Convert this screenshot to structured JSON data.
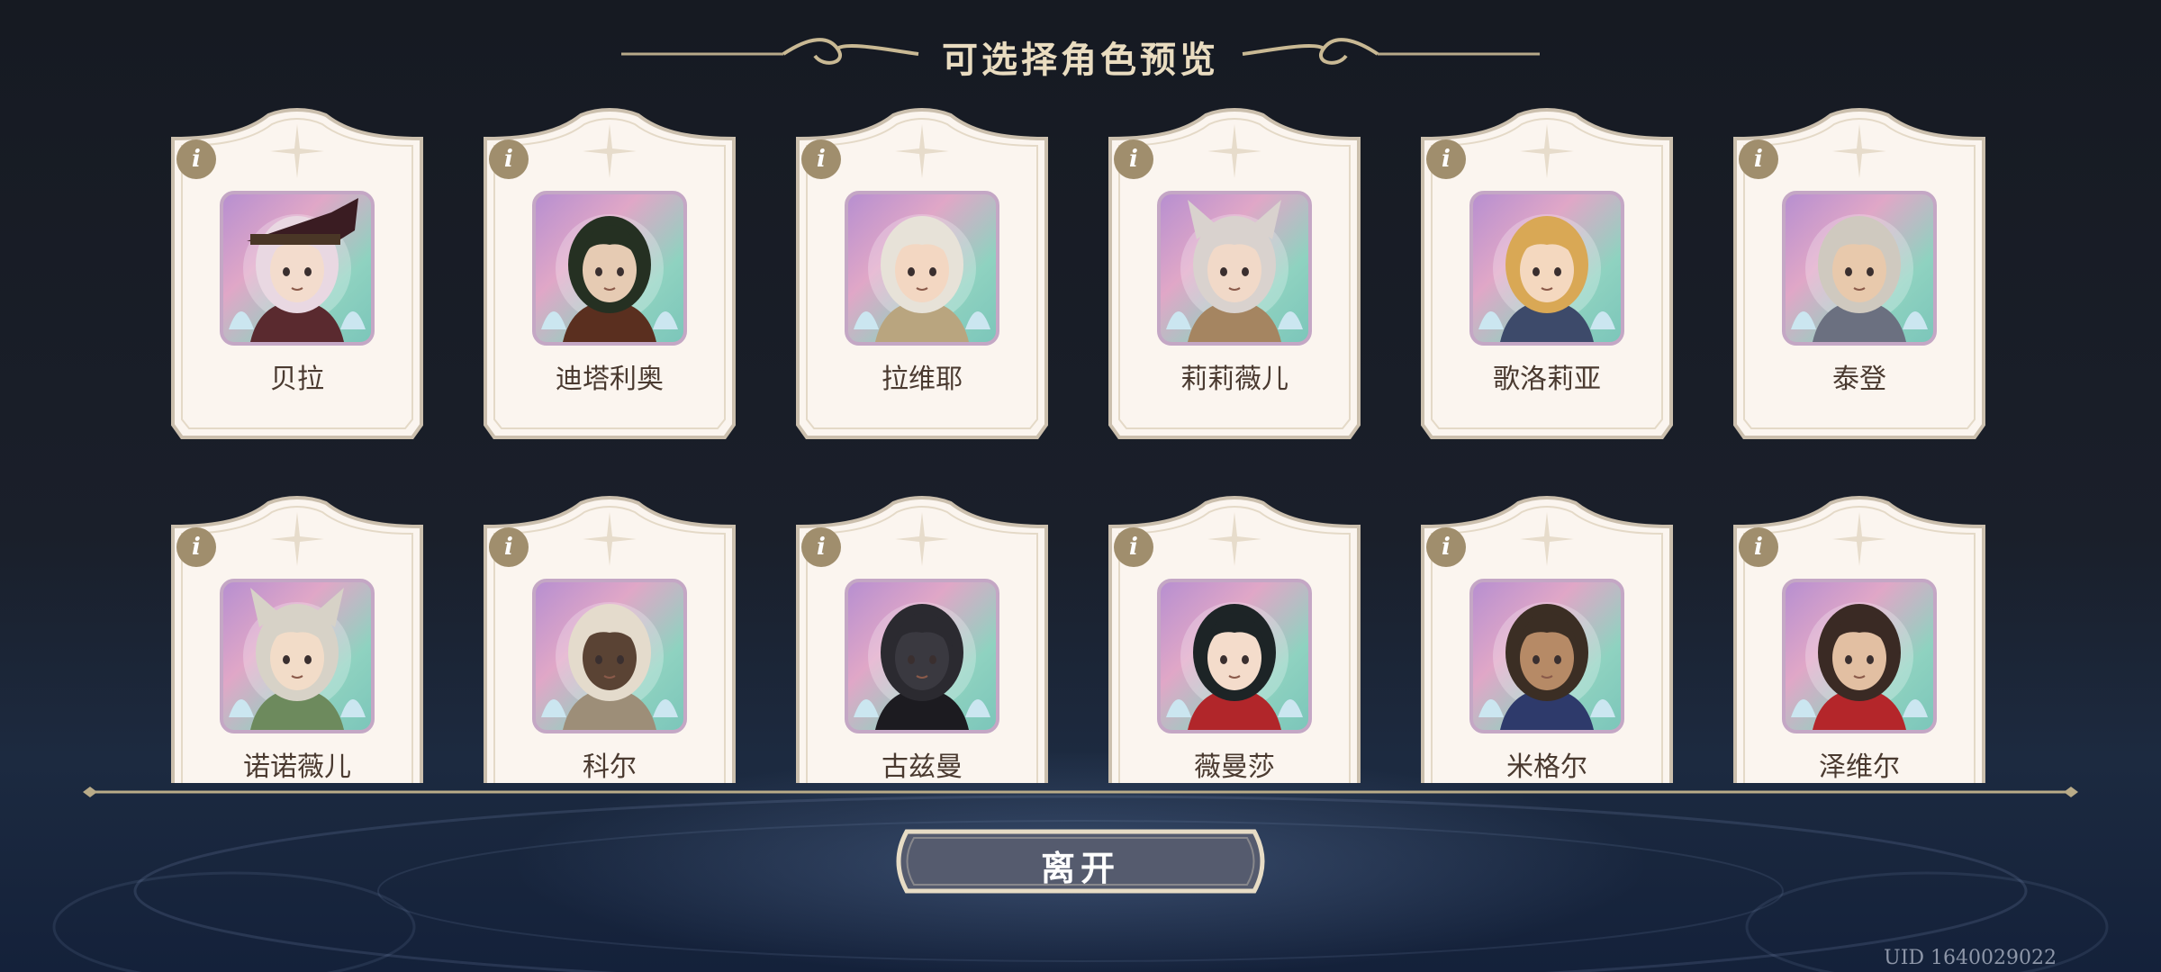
{
  "header": {
    "title": "可选择角色预览"
  },
  "characters": [
    {
      "name": "贝拉",
      "hair": "#e9d8e2",
      "skin": "#f3dccd",
      "accent": "#5a2a2f",
      "hat": true
    },
    {
      "name": "迪塔利奥",
      "hair": "#253022",
      "skin": "#e6cbb3",
      "accent": "#5a2f1f"
    },
    {
      "name": "拉维耶",
      "hair": "#e7e2d8",
      "skin": "#f3d7c2",
      "accent": "#b9a57f"
    },
    {
      "name": "莉莉薇儿",
      "hair": "#d9d2ce",
      "skin": "#f1d9c8",
      "accent": "#a58561",
      "ears": true
    },
    {
      "name": "歌洛莉亚",
      "hair": "#d9a855",
      "skin": "#f4d8bf",
      "accent": "#3d4a6a"
    },
    {
      "name": "泰登",
      "hair": "#cfc9bf",
      "skin": "#e8c9ac",
      "accent": "#6b7080"
    },
    {
      "name": "诺诺薇儿",
      "hair": "#d7d2c7",
      "skin": "#f2dcc8",
      "accent": "#6d8a5d",
      "ears": true
    },
    {
      "name": "科尔",
      "hair": "#e4dbcc",
      "skin": "#5a4334",
      "accent": "#9d8e78"
    },
    {
      "name": "古兹曼",
      "hair": "#2b2a30",
      "skin": "#3a3940",
      "accent": "#1c1b20"
    },
    {
      "name": "薇曼莎",
      "hair": "#1d2426",
      "skin": "#f4dccb",
      "accent": "#b1262a"
    },
    {
      "name": "米格尔",
      "hair": "#3b2e24",
      "skin": "#b68a66",
      "accent": "#2e3a6b"
    },
    {
      "name": "泽维尔",
      "hair": "#3a2a24",
      "skin": "#e2bfa2",
      "accent": "#b4262a"
    }
  ],
  "info_label": "i",
  "actions": {
    "leave_label": "离开"
  },
  "footer": {
    "uid": "UID 1640029022"
  },
  "colors": {
    "card_bg": "#fbf5ef",
    "card_border": "#cbbfad",
    "gold": "#b9a77d",
    "button": "#555b6e"
  }
}
